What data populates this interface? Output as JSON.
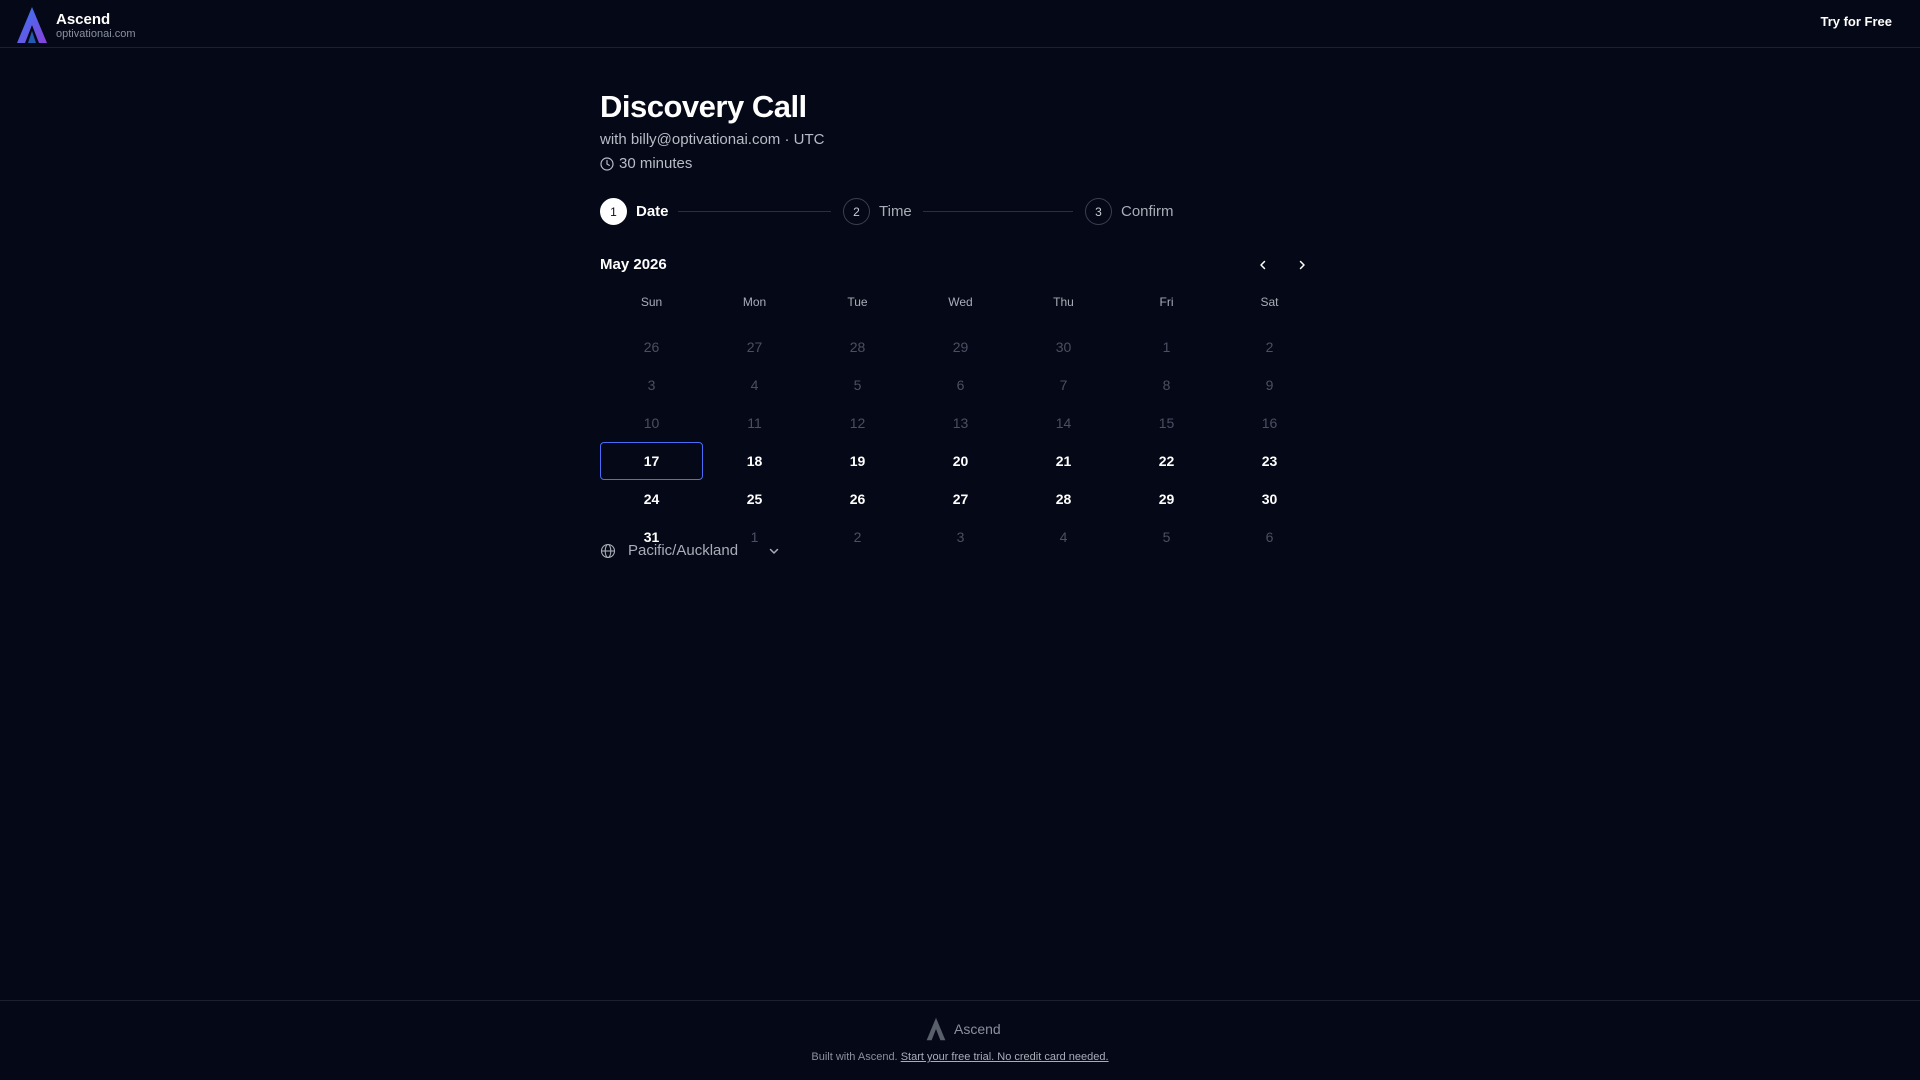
{
  "header": {
    "brand_name": "Ascend",
    "brand_domain": "optivationai.com",
    "cta_label": "Try for Free"
  },
  "event": {
    "title": "Discovery Call",
    "subtitle": "with billy@optivationai.com · UTC",
    "duration": "30 minutes"
  },
  "steps": [
    {
      "num": "1",
      "label": "Date",
      "active": true
    },
    {
      "num": "2",
      "label": "Time",
      "active": false
    },
    {
      "num": "3",
      "label": "Confirm",
      "active": false
    }
  ],
  "calendar": {
    "month_label": "May 2026",
    "weekdays": [
      "Sun",
      "Mon",
      "Tue",
      "Wed",
      "Thu",
      "Fri",
      "Sat"
    ],
    "days": [
      {
        "d": "26",
        "s": "muted"
      },
      {
        "d": "27",
        "s": "muted"
      },
      {
        "d": "28",
        "s": "muted"
      },
      {
        "d": "29",
        "s": "muted"
      },
      {
        "d": "30",
        "s": "muted"
      },
      {
        "d": "1",
        "s": "muted"
      },
      {
        "d": "2",
        "s": "muted"
      },
      {
        "d": "3",
        "s": "muted"
      },
      {
        "d": "4",
        "s": "muted"
      },
      {
        "d": "5",
        "s": "muted"
      },
      {
        "d": "6",
        "s": "muted"
      },
      {
        "d": "7",
        "s": "muted"
      },
      {
        "d": "8",
        "s": "muted"
      },
      {
        "d": "9",
        "s": "muted"
      },
      {
        "d": "10",
        "s": "muted"
      },
      {
        "d": "11",
        "s": "muted"
      },
      {
        "d": "12",
        "s": "muted"
      },
      {
        "d": "13",
        "s": "muted"
      },
      {
        "d": "14",
        "s": "muted"
      },
      {
        "d": "15",
        "s": "muted"
      },
      {
        "d": "16",
        "s": "muted"
      },
      {
        "d": "17",
        "s": "selected"
      },
      {
        "d": "18",
        "s": "avail"
      },
      {
        "d": "19",
        "s": "avail"
      },
      {
        "d": "20",
        "s": "avail"
      },
      {
        "d": "21",
        "s": "avail"
      },
      {
        "d": "22",
        "s": "avail"
      },
      {
        "d": "23",
        "s": "avail"
      },
      {
        "d": "24",
        "s": "avail"
      },
      {
        "d": "25",
        "s": "avail"
      },
      {
        "d": "26",
        "s": "avail"
      },
      {
        "d": "27",
        "s": "avail"
      },
      {
        "d": "28",
        "s": "avail"
      },
      {
        "d": "29",
        "s": "avail"
      },
      {
        "d": "30",
        "s": "avail"
      },
      {
        "d": "31",
        "s": "avail"
      },
      {
        "d": "1",
        "s": "muted"
      },
      {
        "d": "2",
        "s": "muted"
      },
      {
        "d": "3",
        "s": "muted"
      },
      {
        "d": "4",
        "s": "muted"
      },
      {
        "d": "5",
        "s": "muted"
      },
      {
        "d": "6",
        "s": "muted"
      }
    ],
    "timezone": "Pacific/Auckland"
  },
  "footer": {
    "brand_name": "Ascend",
    "built_with": "Built with Ascend.",
    "link_text": "Start your free trial. No credit card needed."
  },
  "colors": {
    "background": "#050816",
    "selected_border": "#4a6cf7",
    "logo_gradient_start": "#3b6cf6",
    "logo_gradient_end": "#8b3fd9"
  },
  "icons": [
    "ascend-logo-icon",
    "clock-icon",
    "chevron-left-icon",
    "chevron-right-icon",
    "globe-icon",
    "chevron-down-icon"
  ]
}
